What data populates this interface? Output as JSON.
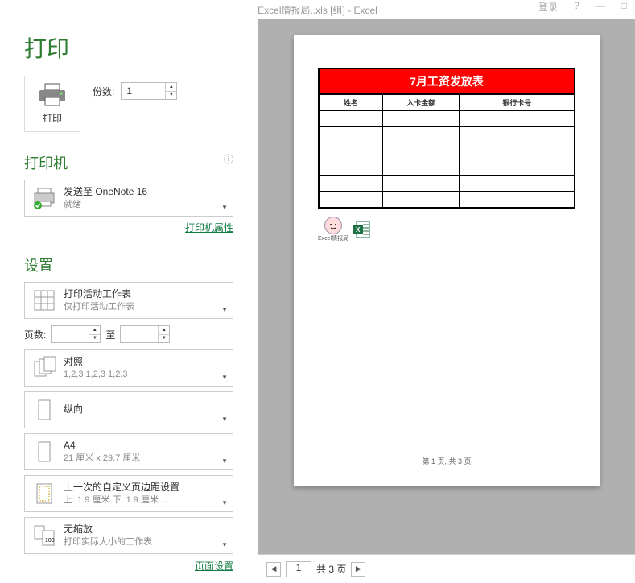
{
  "titlebar": {
    "filename": "Excel情报局..xls [组] - Excel",
    "login": "登录",
    "help": "?",
    "minimize": "—",
    "restore": "□"
  },
  "page_title": "打印",
  "print_button": {
    "label": "打印"
  },
  "copies": {
    "label": "份数:",
    "value": "1"
  },
  "printer": {
    "section": "打印机",
    "name": "发送至 OneNote 16",
    "status": "就绪",
    "props_link": "打印机属性"
  },
  "settings": {
    "section": "设置",
    "scope": {
      "primary": "打印活动工作表",
      "secondary": "仅打印活动工作表"
    },
    "pages": {
      "label": "页数:",
      "to": "至"
    },
    "collate": {
      "primary": "对照",
      "secondary": "1,2,3    1,2,3    1,2,3"
    },
    "orientation": {
      "primary": "纵向"
    },
    "paper": {
      "primary": "A4",
      "secondary": "21 厘米 x 29.7 厘米"
    },
    "margins": {
      "primary": "上一次的自定义页边距设置",
      "secondary": "上: 1.9 厘米 下: 1.9 厘米 …"
    },
    "scaling": {
      "primary": "无缩放",
      "secondary": "打印实际大小的工作表",
      "badge": "100"
    },
    "page_setup_link": "页面设置"
  },
  "preview": {
    "table_title": "7月工资发放表",
    "cols": [
      "姓名",
      "入卡金额",
      "银行卡号"
    ],
    "brand": "Excel情报局",
    "footer": "第 1 页, 共 3 页"
  },
  "navbar": {
    "current": "1",
    "total_text": "共 3 页"
  }
}
